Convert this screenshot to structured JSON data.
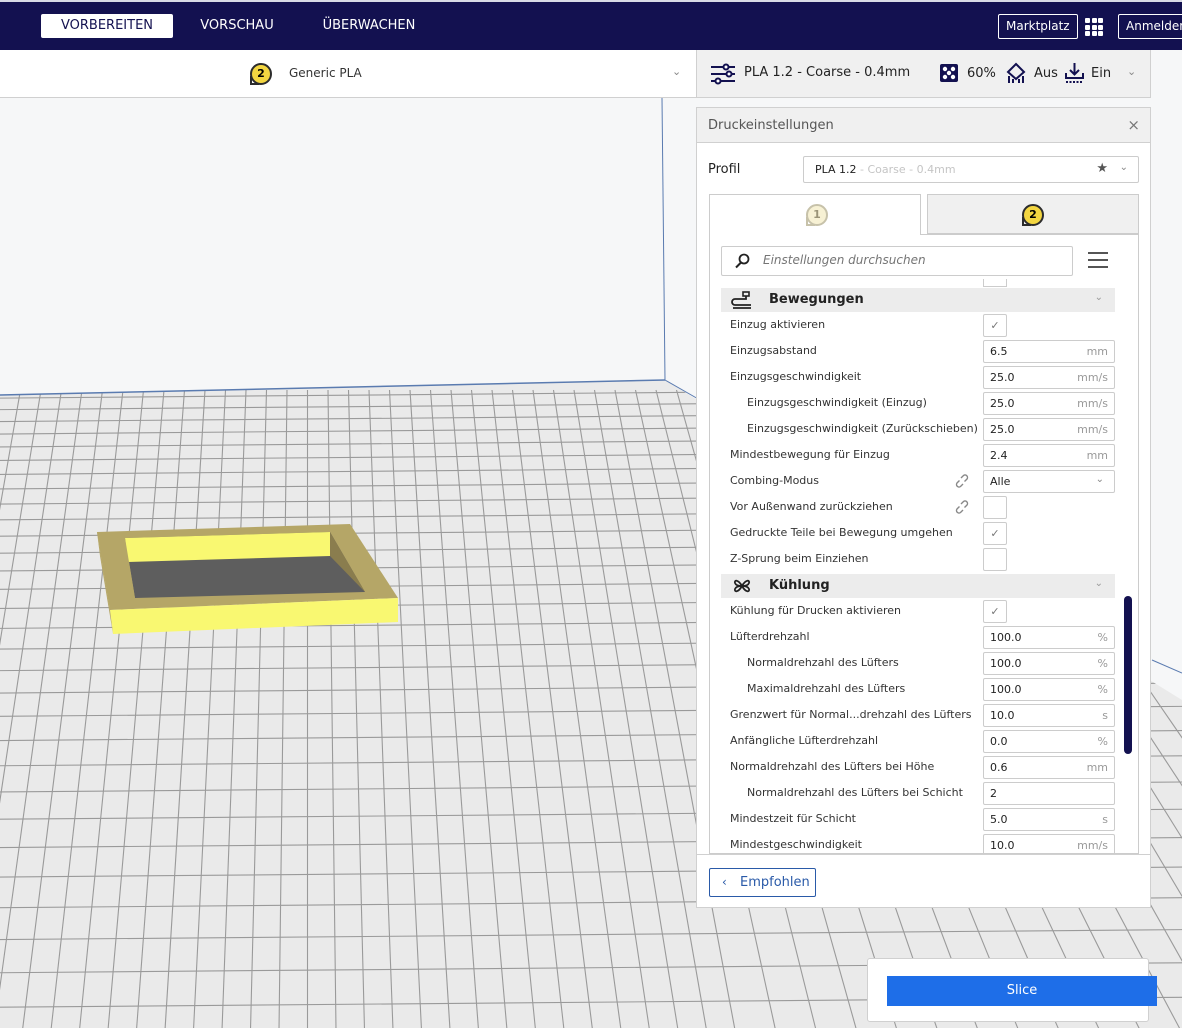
{
  "topbar": {
    "tabs": [
      {
        "label": "VORBEREITEN",
        "active": true
      },
      {
        "label": "VORSCHAU",
        "active": false
      },
      {
        "label": "ÜBERWACHEN",
        "active": false
      }
    ],
    "marketplace_label": "Marktplatz",
    "signin_label": "Anmelden",
    "apps_icon": "apps-grid-icon"
  },
  "material_bar": {
    "extruder_number": "2",
    "material_name": "Generic PLA",
    "chevron": "⌄"
  },
  "print_bar": {
    "profile_summary": "PLA 1.2 - Coarse - 0.4mm",
    "infill": "60%",
    "support": "Aus",
    "adhesion": "Ein",
    "chevron": "⌄"
  },
  "settings_panel": {
    "title": "Druckeinstellungen",
    "close_glyph": "×",
    "profile_label": "Profil",
    "profile_value": "PLA 1.2",
    "profile_value_sub": " - Coarse - 0.4mm",
    "star_glyph": "★",
    "chevron": "⌄",
    "extruder_tabs": [
      {
        "number": "1",
        "active": true
      },
      {
        "number": "2",
        "active": false
      }
    ],
    "search_placeholder": "Einstellungen durchsuchen",
    "categories": {
      "travel": {
        "label": "Bewegungen",
        "icon": "travel-icon"
      },
      "cooling": {
        "label": "Kühlung",
        "icon": "fan-icon"
      }
    },
    "travel_settings": [
      {
        "label": "Einzug aktivieren",
        "type": "checkbox",
        "checked": true
      },
      {
        "label": "Einzugsabstand",
        "type": "field",
        "value": "6.5",
        "unit": "mm"
      },
      {
        "label": "Einzugsgeschwindigkeit",
        "type": "field",
        "value": "25.0",
        "unit": "mm/s"
      },
      {
        "label": "Einzugsgeschwindigkeit (Einzug)",
        "type": "field",
        "value": "25.0",
        "unit": "mm/s",
        "indent": true
      },
      {
        "label": "Einzugsgeschwindigkeit (Zurückschieben)",
        "type": "field",
        "value": "25.0",
        "unit": "mm/s",
        "indent": true
      },
      {
        "label": "Mindestbewegung für Einzug",
        "type": "field",
        "value": "2.4",
        "unit": "mm"
      },
      {
        "label": "Combing-Modus",
        "type": "select",
        "value": "Alle",
        "linked": true
      },
      {
        "label": "Vor Außenwand zurückziehen",
        "type": "checkbox",
        "checked": false,
        "linked": true
      },
      {
        "label": "Gedruckte Teile bei Bewegung umgehen",
        "type": "checkbox",
        "checked": true
      },
      {
        "label": "Z-Sprung beim Einziehen",
        "type": "checkbox",
        "checked": false
      }
    ],
    "cooling_settings": [
      {
        "label": "Kühlung für Drucken aktivieren",
        "type": "checkbox",
        "checked": true
      },
      {
        "label": "Lüfterdrehzahl",
        "type": "field",
        "value": "100.0",
        "unit": "%"
      },
      {
        "label": "Normaldrehzahl des Lüfters",
        "type": "field",
        "value": "100.0",
        "unit": "%",
        "indent": true
      },
      {
        "label": "Maximaldrehzahl des Lüfters",
        "type": "field",
        "value": "100.0",
        "unit": "%",
        "indent": true
      },
      {
        "label": "Grenzwert für Normal...drehzahl des Lüfters",
        "type": "field",
        "value": "10.0",
        "unit": "s"
      },
      {
        "label": "Anfängliche Lüfterdrehzahl",
        "type": "field",
        "value": "0.0",
        "unit": "%"
      },
      {
        "label": "Normaldrehzahl des Lüfters bei Höhe",
        "type": "field",
        "value": "0.6",
        "unit": "mm"
      },
      {
        "label": "Normaldrehzahl des Lüfters bei Schicht",
        "type": "field",
        "value": "2",
        "unit": "",
        "indent": true
      },
      {
        "label": "Mindestzeit für Schicht",
        "type": "field",
        "value": "5.0",
        "unit": "s"
      },
      {
        "label": "Mindestgeschwindigkeit",
        "type": "field",
        "value": "10.0",
        "unit": "mm/s"
      }
    ],
    "check_glyph": "✓",
    "recommended_label": "Empfohlen",
    "recommended_chevron": "‹"
  },
  "slice": {
    "label": "Slice"
  },
  "colors": {
    "topbar": "#131150",
    "accent_blue": "#1e6ee8",
    "model_yellow": "#f9f871",
    "model_shadow": "#b5a667",
    "extruder_badge": "#f3d641"
  }
}
